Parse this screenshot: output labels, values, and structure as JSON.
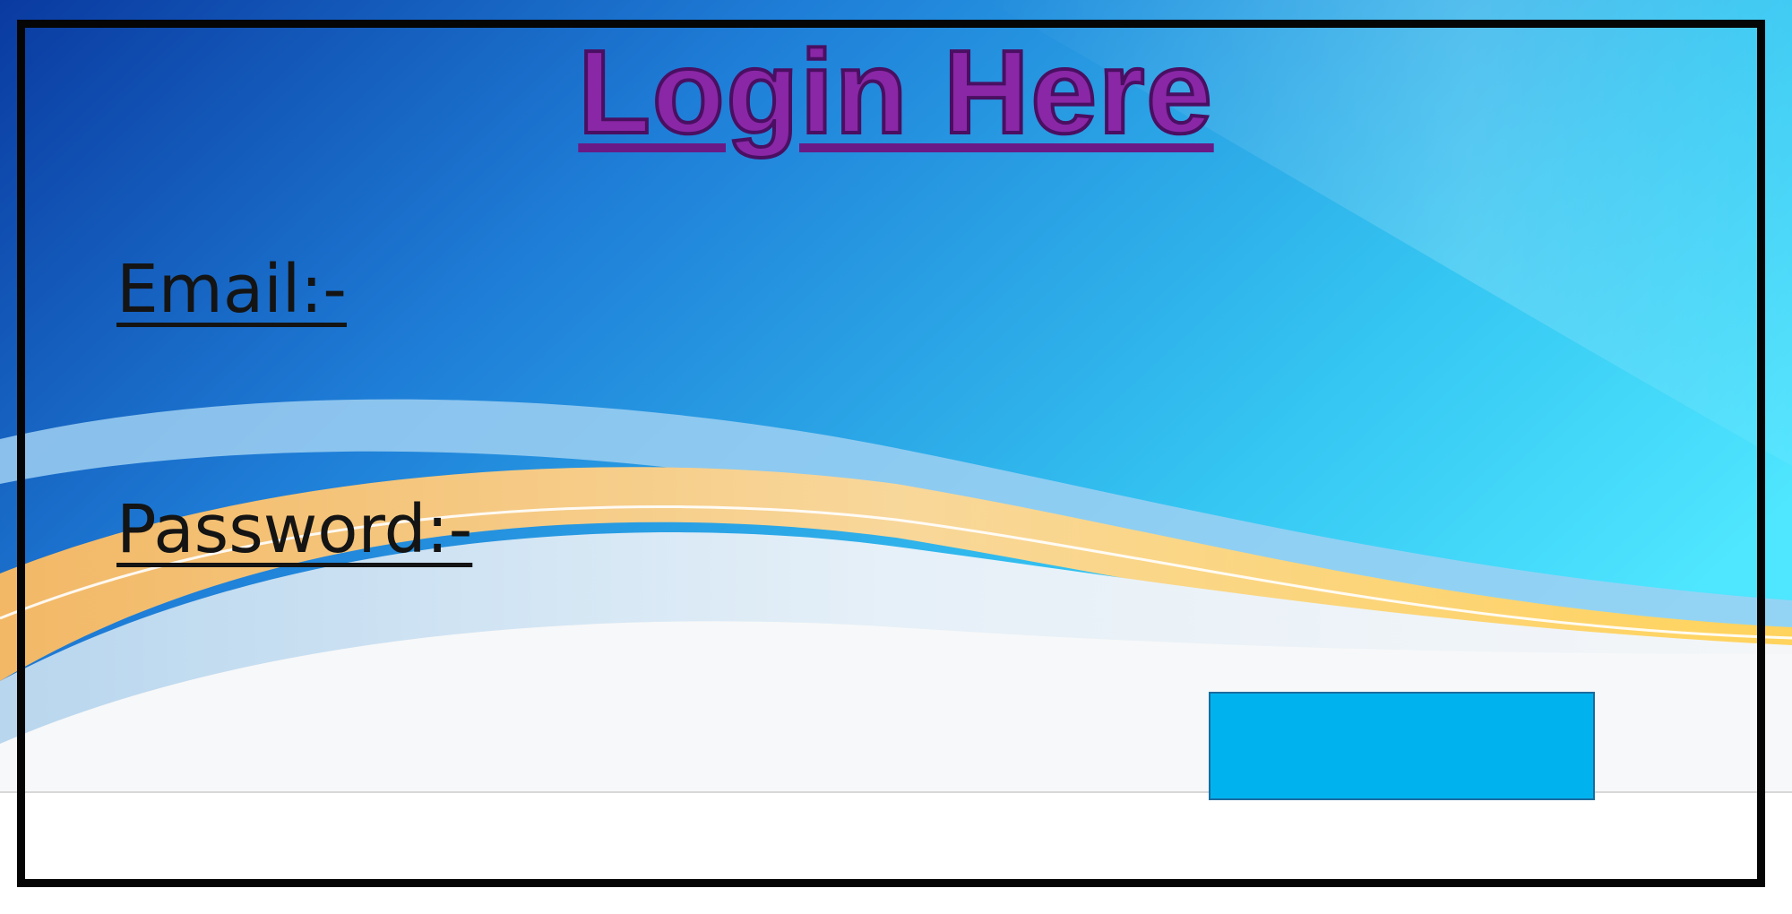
{
  "login_form": {
    "title": "Login Here",
    "email_label": "Email:-",
    "password_label": "Password:-",
    "submit_label": ""
  },
  "colors": {
    "title": "#8a27a6",
    "button": "#00b2ee",
    "frame": "#050505"
  }
}
